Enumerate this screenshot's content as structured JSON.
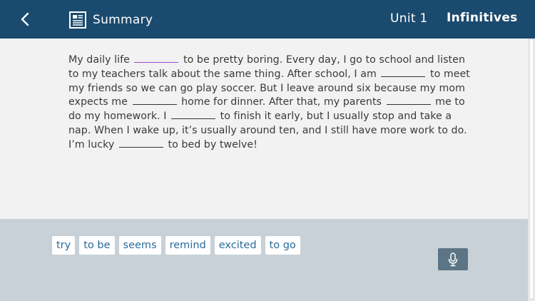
{
  "header": {
    "back_icon": "chevron-left-icon",
    "summary_icon": "document-icon",
    "summary_label": "Summary",
    "unit_label": "Unit 1",
    "unit_title": "Infinitives"
  },
  "passage": {
    "seg0": "My daily life",
    "seg1": "to be pretty boring. Every day, I go to school and listen to my teachers talk about the same thing. After school, I am",
    "seg2": "to meet my friends so we can go play soccer. But I leave around six because my mom expects me",
    "seg3": "home for dinner. After that, my parents",
    "seg4": "me to do my homework. I",
    "seg5": "to finish it early, but I usually stop and take a nap. When I wake up, it’s usually around ten, and I still have more work to do. I’m lucky",
    "seg6": "to bed by twelve!"
  },
  "word_bank": [
    "try",
    "to be",
    "seems",
    "remind",
    "excited",
    "to go"
  ],
  "mic_icon": "microphone-icon",
  "colors": {
    "header_bg": "#1a4a6e",
    "passage_bg": "#f2f2f2",
    "footer_bg": "#c8d1d8",
    "chip_text": "#2a6a9a",
    "active_blank": "#a24ad2",
    "mic_bg": "#5b7486"
  }
}
